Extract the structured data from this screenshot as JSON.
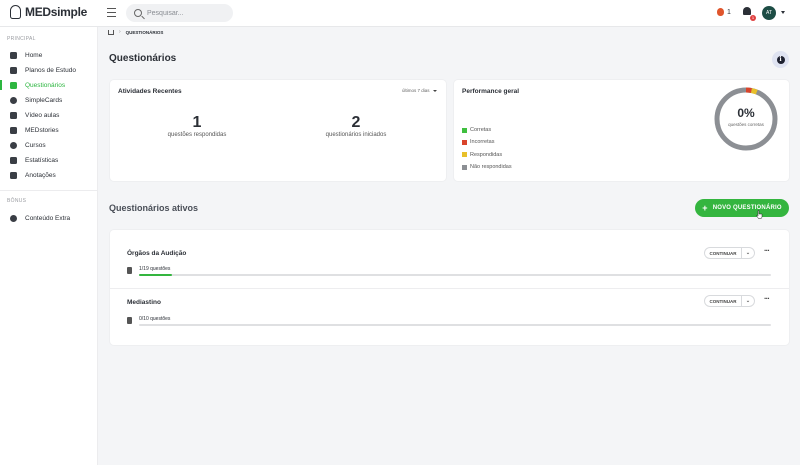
{
  "header": {
    "logo": "MEDsimple",
    "search_placeholder": "Pesquisar...",
    "streak_count": "1",
    "notification_count": "1",
    "avatar_initials": "AT"
  },
  "sidebar": {
    "section_main": "PRINCIPAL",
    "items": [
      {
        "label": "Home",
        "icon": "home-icon"
      },
      {
        "label": "Planos de Estudo",
        "icon": "book-icon"
      },
      {
        "label": "Questionários",
        "icon": "checklist-icon"
      },
      {
        "label": "SimpleCards",
        "icon": "cards-icon"
      },
      {
        "label": "Vídeo aulas",
        "icon": "video-icon"
      },
      {
        "label": "MEDstories",
        "icon": "stories-icon"
      },
      {
        "label": "Cursos",
        "icon": "courses-icon"
      },
      {
        "label": "Estatísticas",
        "icon": "stats-icon"
      },
      {
        "label": "Anotações",
        "icon": "notes-icon"
      }
    ],
    "active_item": "Questionários",
    "section_bonus": "BÔNUS",
    "bonus_items": [
      {
        "label": "Conteúdo Extra",
        "icon": "badge-icon"
      }
    ]
  },
  "breadcrumb": {
    "current": "QUESTIONÁRIOS"
  },
  "page": {
    "title": "Questionários"
  },
  "recent": {
    "title": "Atividades Recentes",
    "range": "últimos 7 dias",
    "stats": [
      {
        "value": "1",
        "label": "questões respondidas"
      },
      {
        "value": "2",
        "label": "questionários iniciados"
      }
    ]
  },
  "performance": {
    "title": "Performance geral",
    "percent": "0%",
    "percent_label": "questões corretas",
    "legend": [
      {
        "label": "Corretas",
        "color": "#3fbf3f"
      },
      {
        "label": "Incorretas",
        "color": "#d9442b"
      },
      {
        "label": "Respondidas",
        "color": "#e8c02a"
      },
      {
        "label": "Não respondidas",
        "color": "#8c8f94"
      }
    ],
    "segments": {
      "corretas": 0,
      "incorretas": 0.03,
      "respondidas": 0.03,
      "nao_respondidas": 0.94
    }
  },
  "active_quizzes": {
    "heading": "Questionários ativos",
    "new_button": "NOVO QUESTIONÁRIO",
    "items": [
      {
        "title": "Órgãos da Audição",
        "progress": "1/19 questões",
        "fraction": 0.0526,
        "continue_label": "CONTINUAR"
      },
      {
        "title": "Mediastino",
        "progress": "0/10 questões",
        "fraction": 0,
        "continue_label": "CONTINUAR"
      }
    ]
  },
  "colors": {
    "accent": "#34b53f",
    "text": "#2b2f36"
  }
}
